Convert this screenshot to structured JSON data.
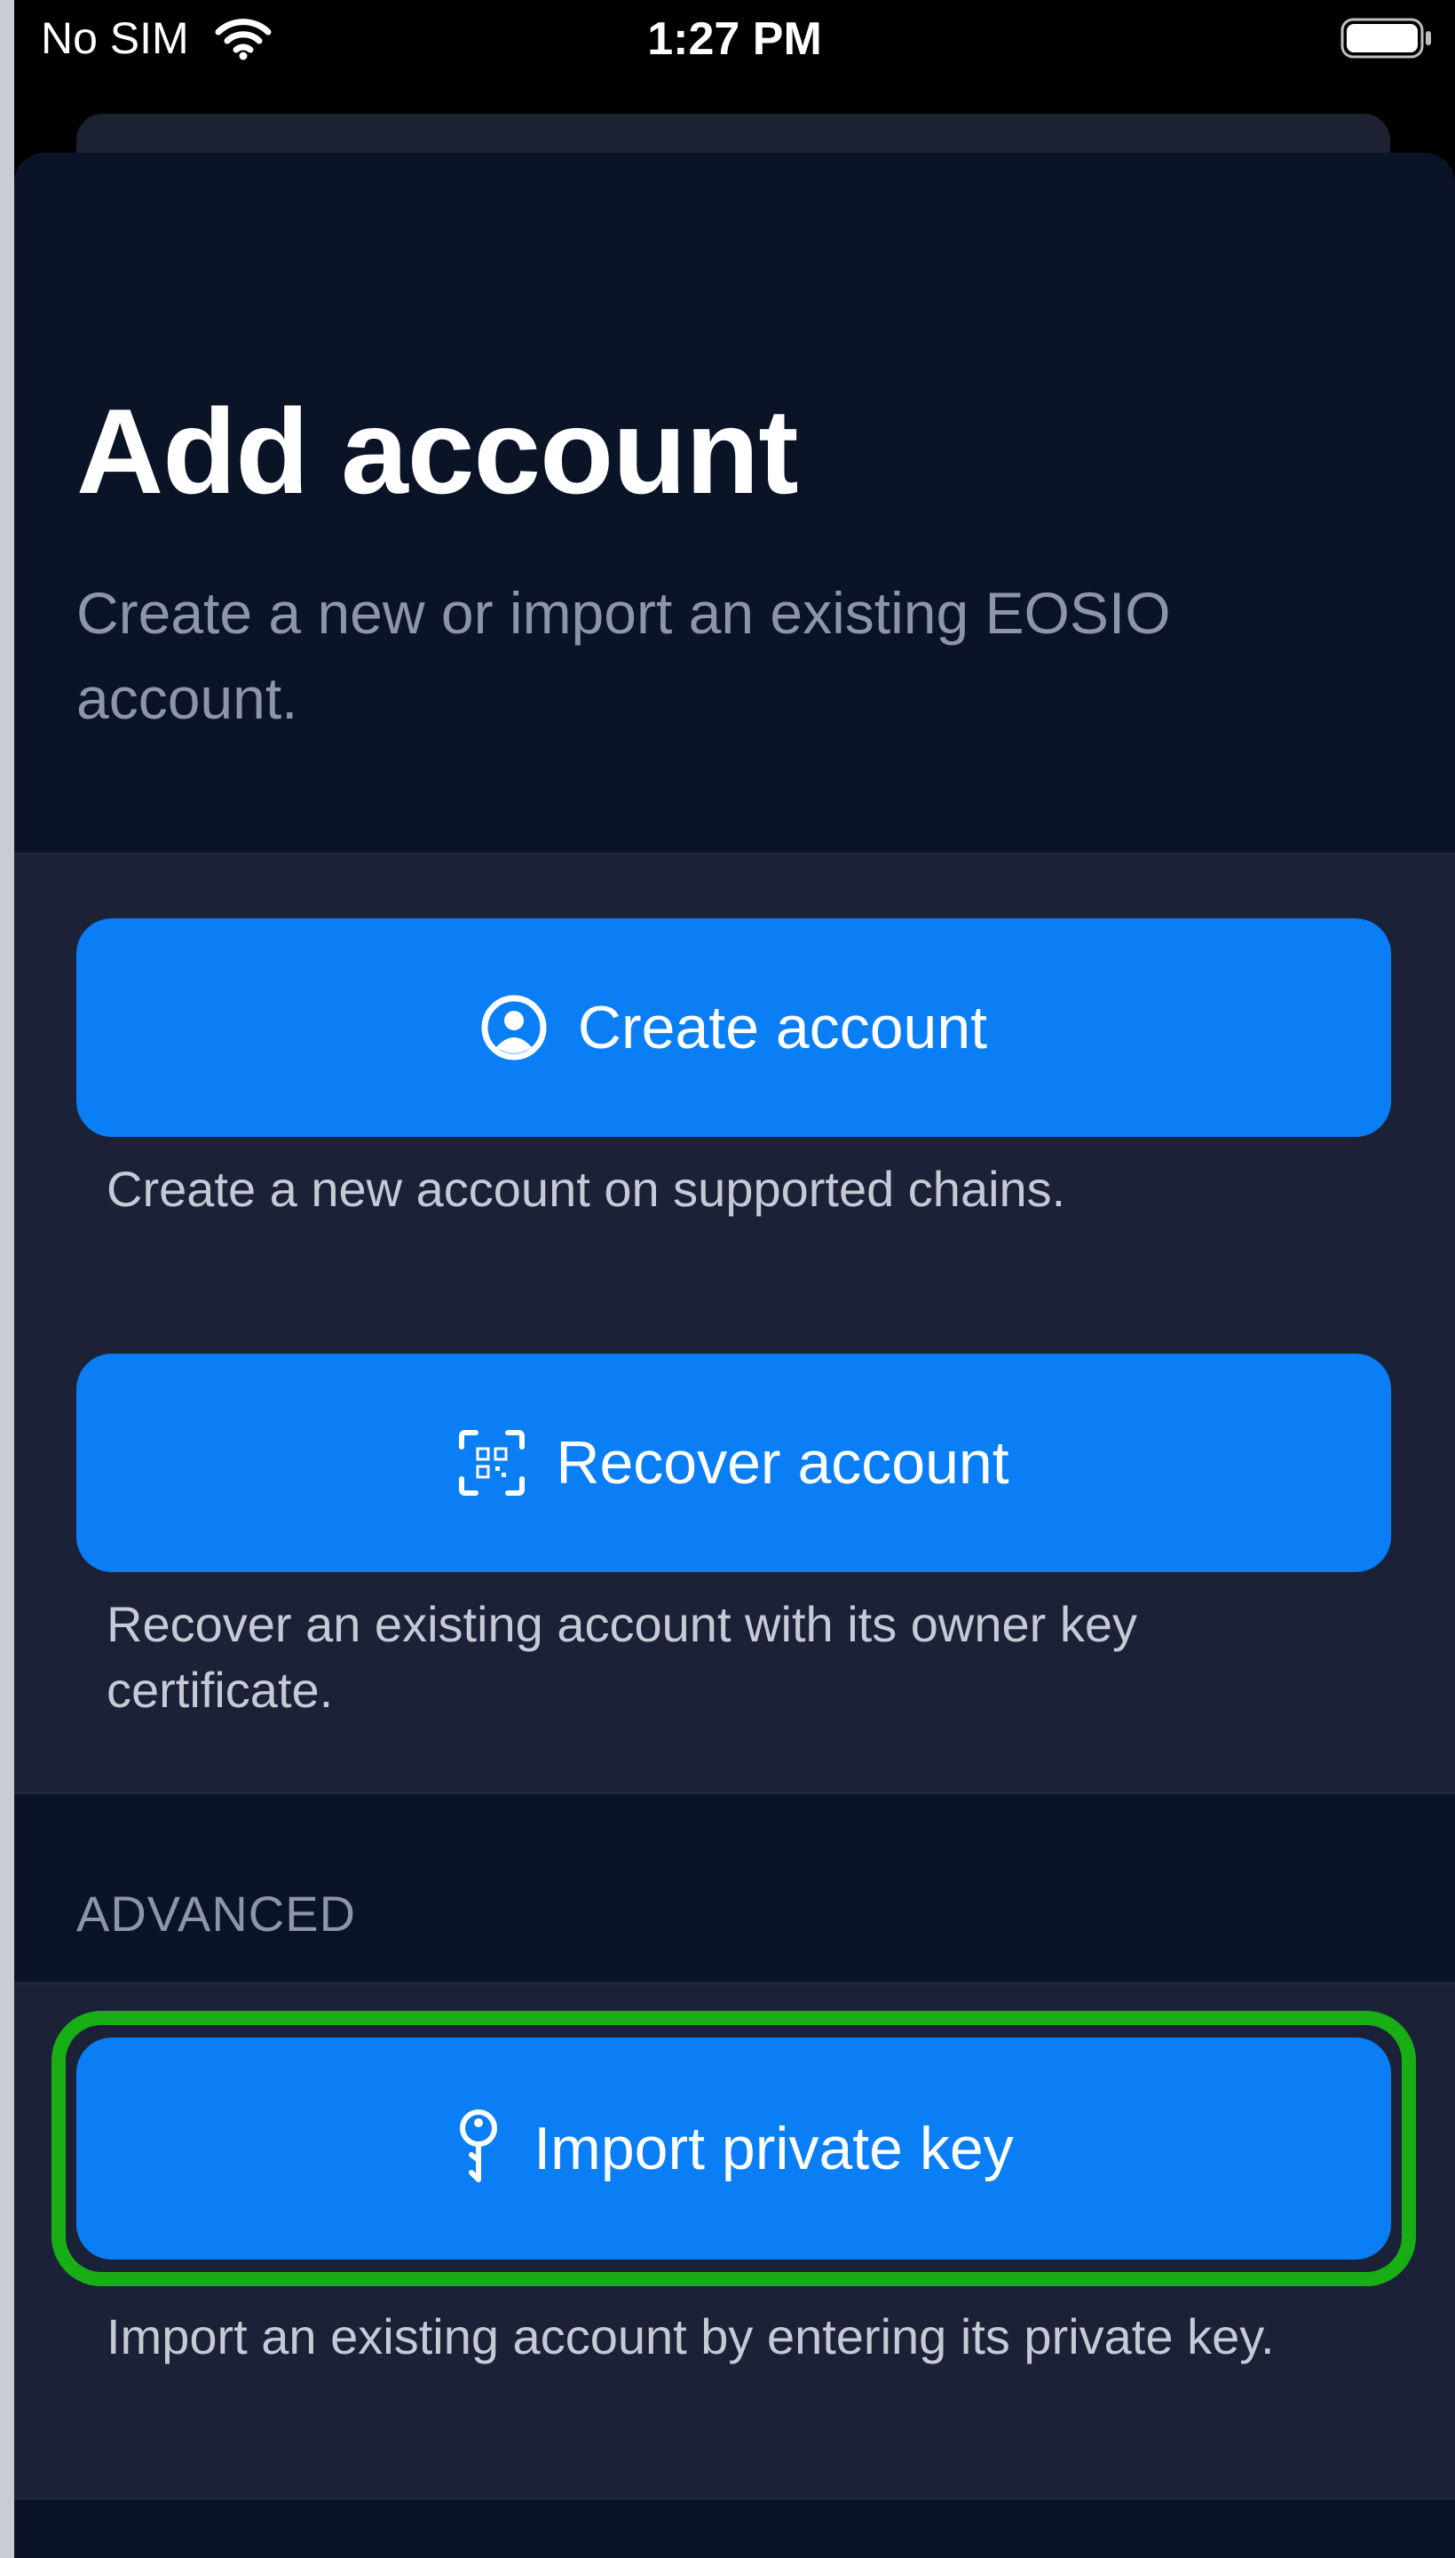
{
  "status_bar": {
    "carrier": "No SIM",
    "time": "1:27 PM",
    "wifi_icon": "wifi-icon",
    "battery_icon": "battery-icon"
  },
  "header": {
    "title": "Add account",
    "subtitle": "Create a new or import an existing EOSIO account."
  },
  "actions": {
    "create": {
      "label": "Create account",
      "icon": "person-circle-icon",
      "description": "Create a new account on supported chains."
    },
    "recover": {
      "label": "Recover account",
      "icon": "qr-scan-icon",
      "description": "Recover an existing account with its owner key certificate."
    }
  },
  "advanced": {
    "header": "ADVANCED",
    "import": {
      "label": "Import private key",
      "icon": "key-icon",
      "description": "Import an existing account by entering its private key."
    }
  },
  "colors": {
    "button": "#0a7ef5",
    "sheet": "#0b1427",
    "section": "#1b2238",
    "highlight": "#19ad16"
  }
}
